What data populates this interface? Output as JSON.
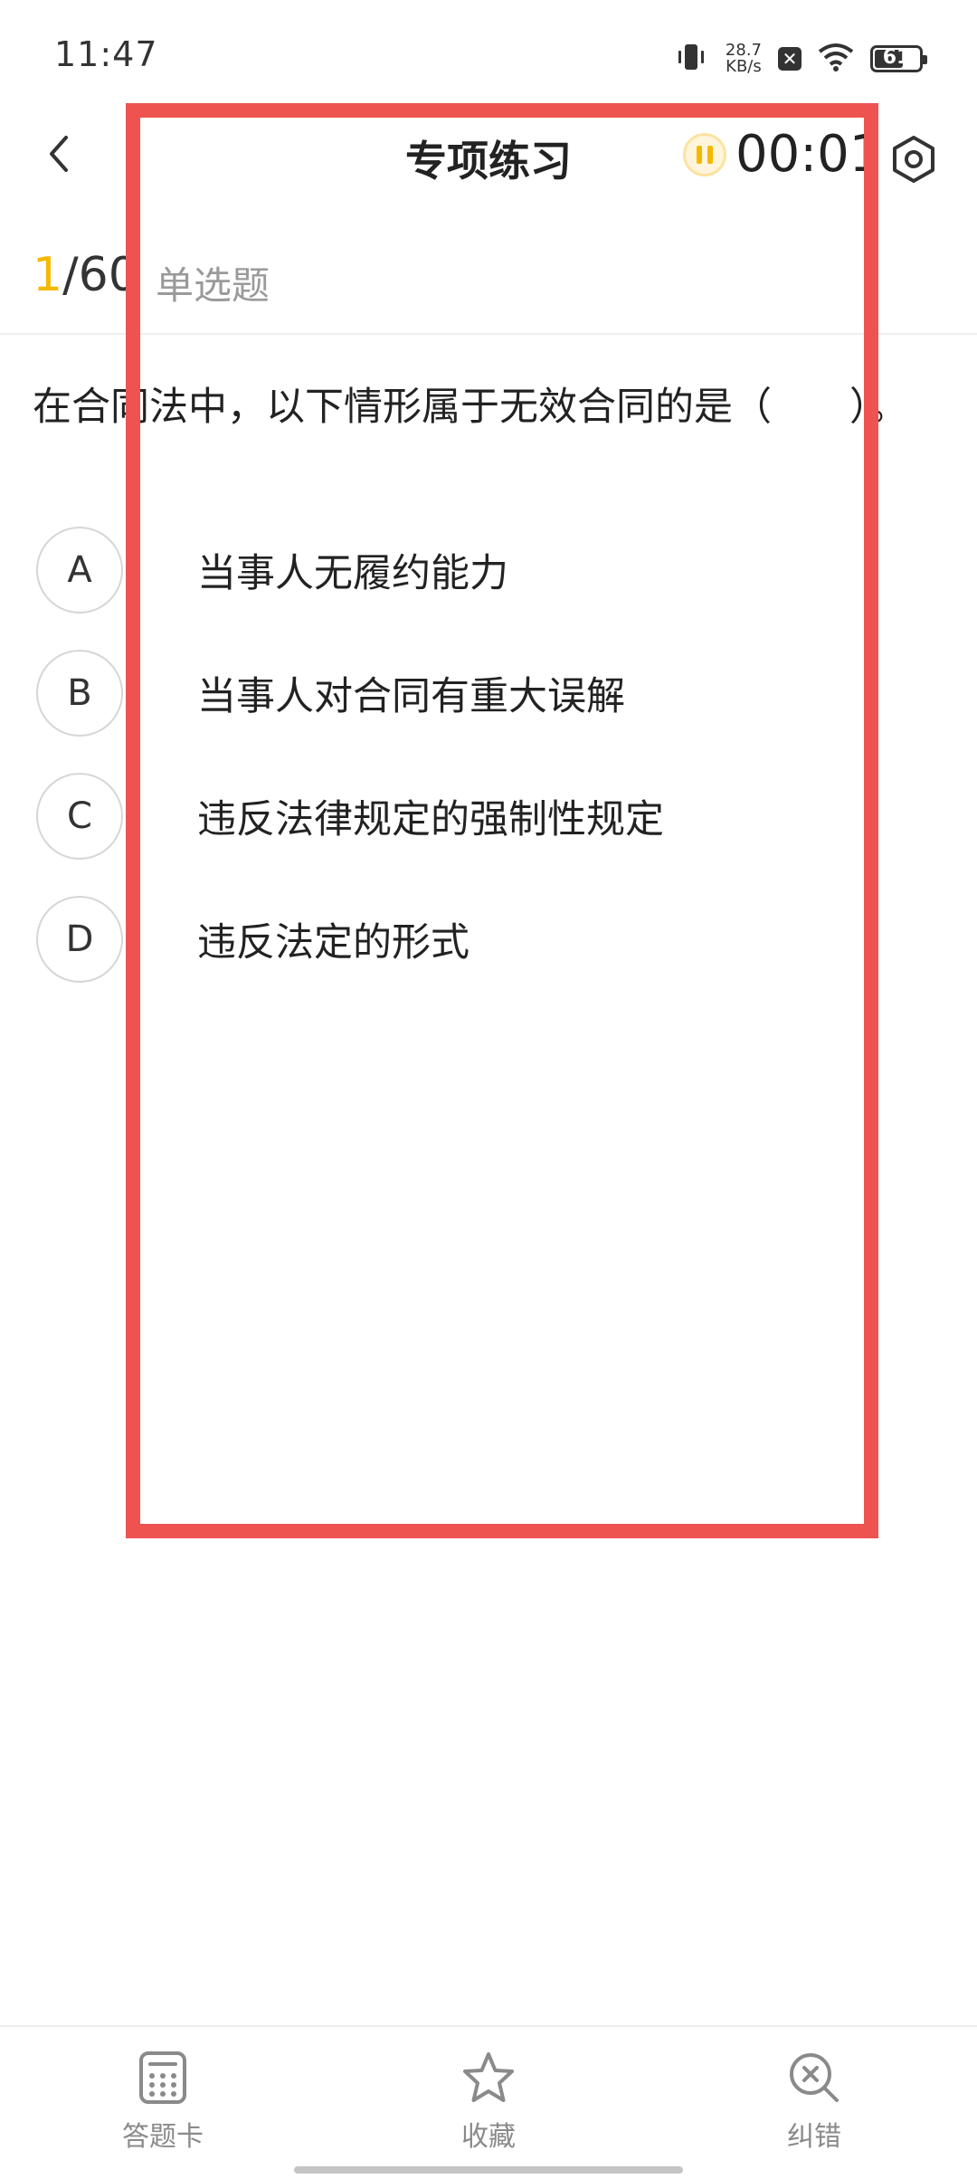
{
  "status_bar": {
    "time": "11:47",
    "net_speed_value": "28.7",
    "net_speed_unit": "KB/s",
    "battery_level": "61"
  },
  "header": {
    "title": "专项练习",
    "timer": "00:01"
  },
  "progress": {
    "current": "1",
    "total": "/60",
    "question_type": "单选题"
  },
  "question": {
    "text": "在合同法中，以下情形属于无效合同的是（　　）。"
  },
  "options": [
    {
      "key": "A",
      "text": "当事人无履约能力"
    },
    {
      "key": "B",
      "text": "当事人对合同有重大误解"
    },
    {
      "key": "C",
      "text": "违反法律规定的强制性规定"
    },
    {
      "key": "D",
      "text": "违反法定的形式"
    }
  ],
  "bottom_tabs": [
    {
      "label": "答题卡",
      "icon": "calculator-icon"
    },
    {
      "label": "收藏",
      "icon": "star-icon"
    },
    {
      "label": "纠错",
      "icon": "search-x-icon"
    }
  ],
  "colors": {
    "accent": "#f5b800",
    "highlight": "#ee5350"
  }
}
